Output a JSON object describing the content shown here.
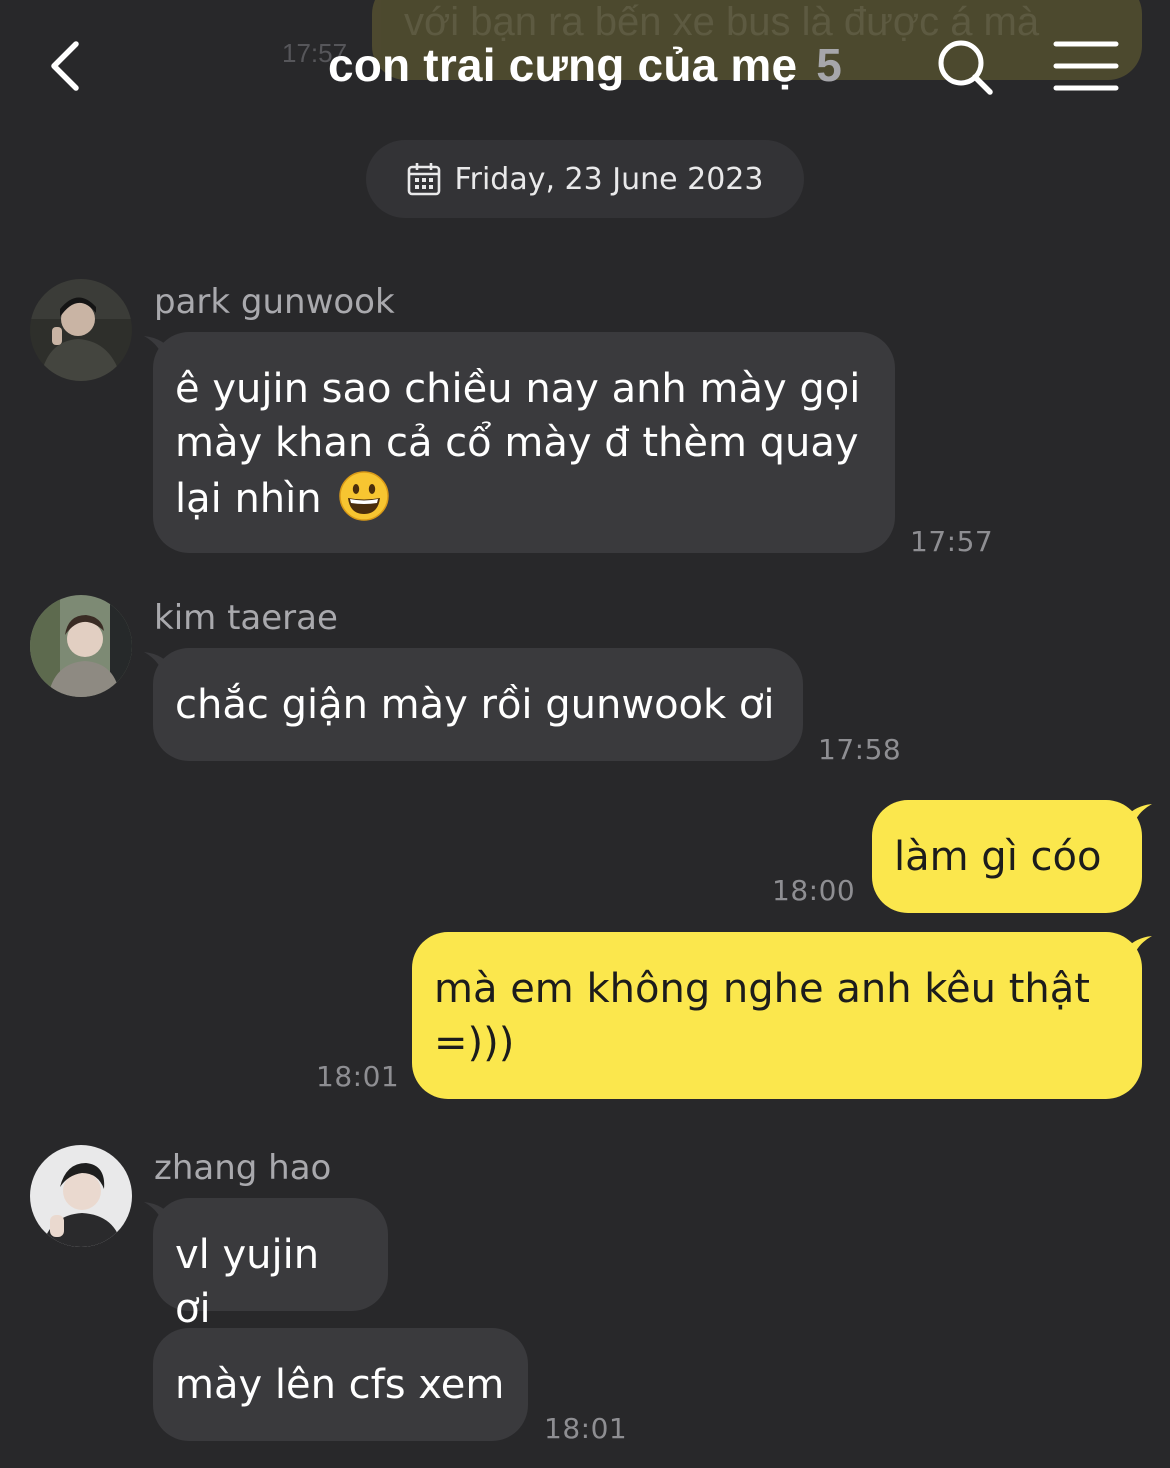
{
  "header": {
    "title": "con trai cưng của mẹ",
    "member_count": "5",
    "prev_message_partial": "với bạn ra bến xe bus là được á mà",
    "prev_time_partial": "17:57"
  },
  "date_divider": "Friday, 23 June 2023",
  "messages": [
    {
      "sender": "park gunwook",
      "text": "ê yujin sao chiều nay anh mày gọi mày khan cả cổ mày đ thèm quay lại nhìn",
      "emoji": "grinning-face",
      "time": "17:57"
    },
    {
      "sender": "kim taerae",
      "text": "chắc giận mày rồi gunwook ơi",
      "time": "17:58"
    },
    {
      "sender": "me",
      "text": "làm gì cóo",
      "time": "18:00"
    },
    {
      "sender": "me",
      "text": "mà em không nghe anh kêu thật =)))",
      "time": "18:01"
    },
    {
      "sender": "zhang hao",
      "text": "vl yujin ơi"
    },
    {
      "sender": "zhang hao",
      "text": "mày lên cfs xem",
      "time": "18:01"
    }
  ],
  "colors": {
    "background": "#28282a",
    "incoming_bubble": "#3a3a3d",
    "outgoing_bubble": "#fbe74d"
  }
}
